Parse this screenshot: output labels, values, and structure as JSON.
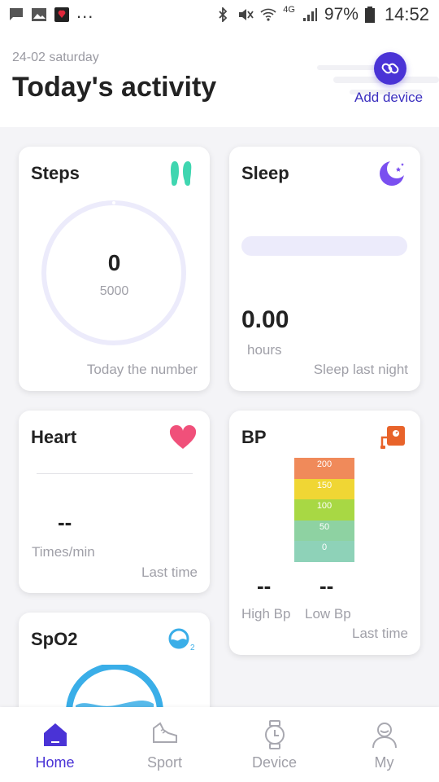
{
  "status_bar": {
    "dots": "...",
    "network": "4G",
    "battery": "97%",
    "time": "14:52",
    "icons": [
      "message-icon",
      "image-icon",
      "app-icon",
      "bluetooth-icon",
      "mute-icon",
      "wifi-icon",
      "signal-icon",
      "battery-icon"
    ]
  },
  "header": {
    "date": "24-02 saturday",
    "title": "Today's activity",
    "add_device_label": "Add device",
    "add_device_icon": "link-icon",
    "accent": "#4a33d6"
  },
  "cards": {
    "steps": {
      "title": "Steps",
      "icon": "footprints-icon",
      "value": "0",
      "goal": "5000",
      "caption": "Today the number",
      "progress": 0,
      "icon_color": "#3fd6b0"
    },
    "sleep": {
      "title": "Sleep",
      "icon": "moon-icon",
      "value": "0.00",
      "unit": "hours",
      "caption": "Sleep last night",
      "icon_color": "#7a4ff0"
    },
    "heart": {
      "title": "Heart",
      "icon": "heart-icon",
      "value": "--",
      "unit": "Times/min",
      "caption": "Last time",
      "icon_color": "#f0507a"
    },
    "bp": {
      "title": "BP",
      "icon": "blood-pressure-icon",
      "scale": [
        {
          "label": "200",
          "color": "#f08a5a"
        },
        {
          "label": "150",
          "color": "#f0d634"
        },
        {
          "label": "100",
          "color": "#a8d844"
        },
        {
          "label": "50",
          "color": "#8ed2a2"
        },
        {
          "label": "0",
          "color": "#8ed2b8"
        }
      ],
      "high_value": "--",
      "low_value": "--",
      "high_label": "High Bp",
      "low_label": "Low Bp",
      "caption": "Last time",
      "icon_color": "#e8632a"
    },
    "spo2": {
      "title": "SpO2",
      "icon": "spo2-icon",
      "icon_color": "#3aaee8"
    }
  },
  "nav": {
    "items": [
      {
        "label": "Home",
        "icon": "home-icon",
        "active": true
      },
      {
        "label": "Sport",
        "icon": "shoe-icon",
        "active": false
      },
      {
        "label": "Device",
        "icon": "watch-icon",
        "active": false
      },
      {
        "label": "My",
        "icon": "user-icon",
        "active": false
      }
    ]
  }
}
